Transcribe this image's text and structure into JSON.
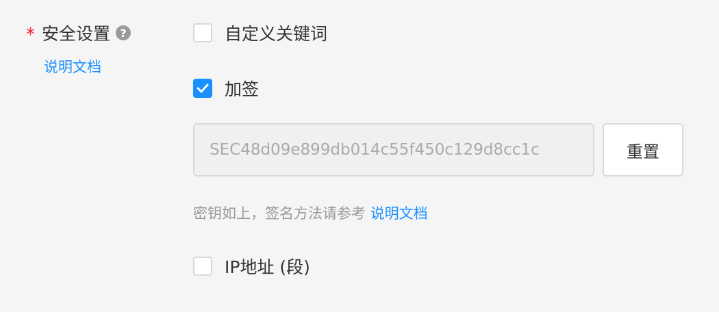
{
  "field": {
    "required_mark": "*",
    "label": "安全设置",
    "help_icon": "question-circle-icon",
    "doc_link": "说明文档"
  },
  "options": {
    "custom_keyword": {
      "label": "自定义关键词",
      "checked": false
    },
    "sign": {
      "label": "加签",
      "checked": true
    },
    "ip_range": {
      "label": "IP地址 (段)",
      "checked": false
    }
  },
  "secret": {
    "value": "SEC48d09e899db014c55f450c129d8cc1c",
    "reset_label": "重置"
  },
  "hint": {
    "text": "密钥如上，签名方法请参考",
    "link": "说明文档"
  },
  "colors": {
    "accent": "#1890ff",
    "required": "#f5222d",
    "background": "#f5f5f6"
  }
}
